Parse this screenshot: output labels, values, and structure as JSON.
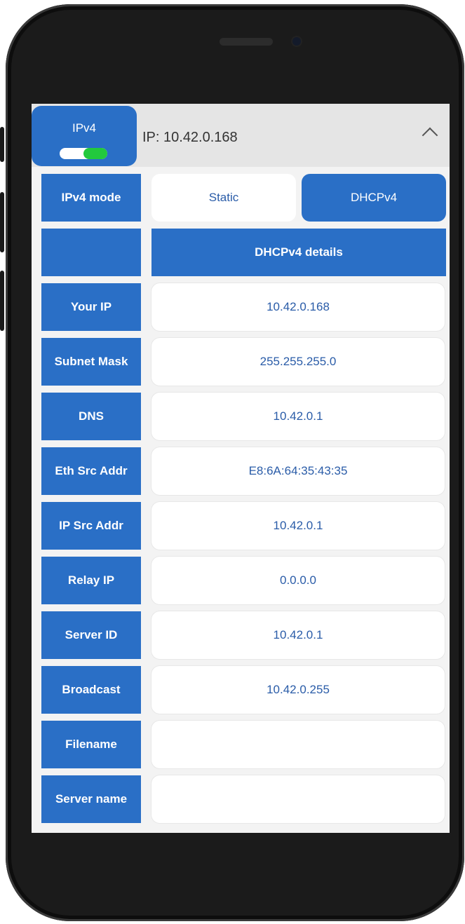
{
  "header": {
    "tab_label": "IPv4",
    "ip_text": "IP: 10.42.0.168",
    "toggle_on": true
  },
  "mode": {
    "label": "IPv4 mode",
    "options": [
      "Static",
      "DHCPv4"
    ],
    "selected": "DHCPv4"
  },
  "details": {
    "title": "DHCPv4 details",
    "rows": [
      {
        "label": "Your IP",
        "value": "10.42.0.168"
      },
      {
        "label": "Subnet Mask",
        "value": "255.255.255.0"
      },
      {
        "label": "DNS",
        "value": "10.42.0.1"
      },
      {
        "label": "Eth Src Addr",
        "value": "E8:6A:64:35:43:35"
      },
      {
        "label": "IP Src Addr",
        "value": "10.42.0.1"
      },
      {
        "label": "Relay IP",
        "value": "0.0.0.0"
      },
      {
        "label": "Server ID",
        "value": "10.42.0.1"
      },
      {
        "label": "Broadcast",
        "value": "10.42.0.255"
      },
      {
        "label": "Filename",
        "value": ""
      },
      {
        "label": "Server name",
        "value": ""
      }
    ]
  },
  "colors": {
    "accent": "#2a6fc6",
    "toggle_green": "#22c93d",
    "value_text": "#2a5ca8"
  },
  "icons": {
    "collapse": "chevron-up-icon"
  }
}
